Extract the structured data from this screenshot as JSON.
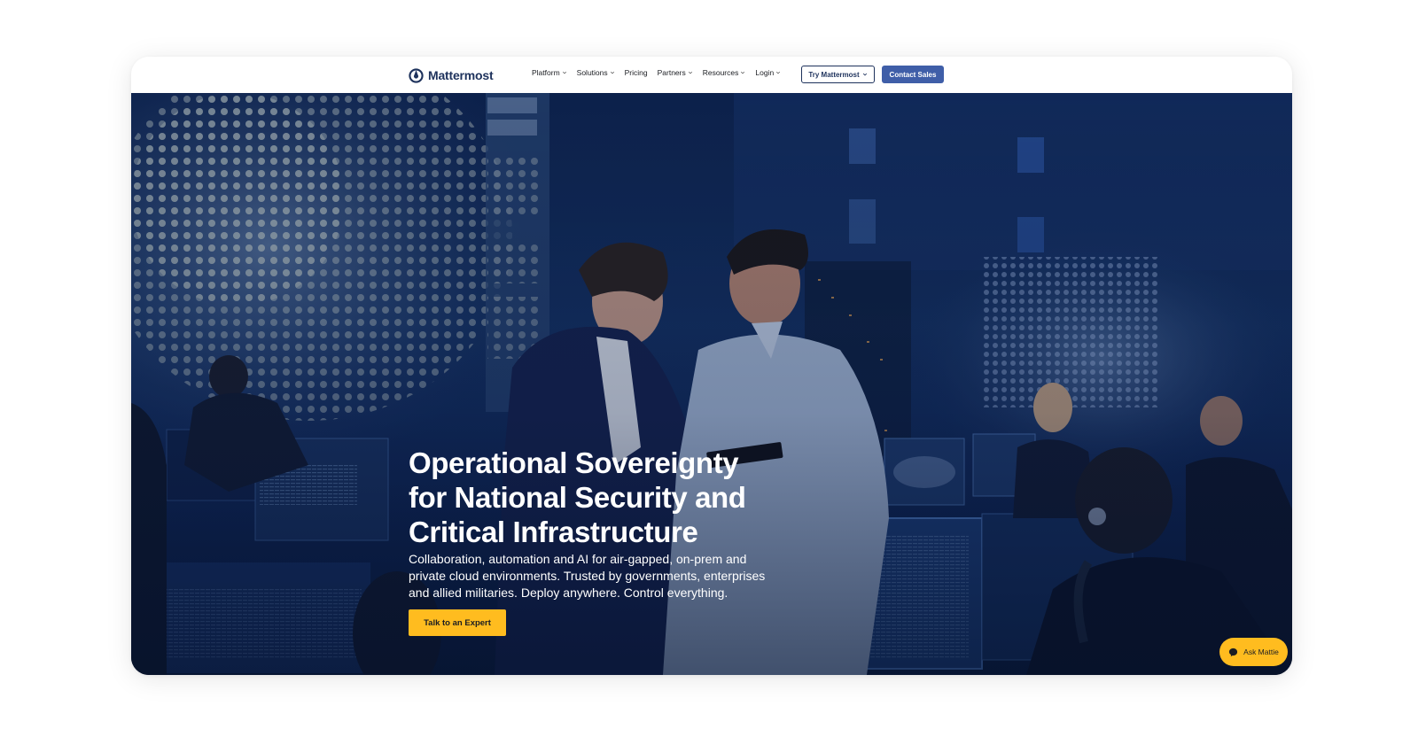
{
  "nav": {
    "logo_text": "Mattermost",
    "logo_icon": "mattermost-logo-icon",
    "links": [
      {
        "label": "Platform",
        "has_dropdown": true
      },
      {
        "label": "Solutions",
        "has_dropdown": true
      },
      {
        "label": "Pricing",
        "has_dropdown": false
      },
      {
        "label": "Partners",
        "has_dropdown": true
      },
      {
        "label": "Resources",
        "has_dropdown": true
      },
      {
        "label": "Login",
        "has_dropdown": true
      }
    ],
    "try_label": "Try Mattermost",
    "sales_label": "Contact Sales"
  },
  "hero": {
    "title": "Operational Sovereignty for National Security and Critical Infrastructure",
    "subtitle": "Collaboration, automation and AI for air-gapped, on-prem and private cloud environments. Trusted by governments, enterprises and allied militaries. Deploy anywhere. Control everything.",
    "cta_label": "Talk to an Expert",
    "background_icon": "control-room-photo"
  },
  "chat_widget": {
    "label": "Ask Mattie",
    "icon": "chat-bubble-icon"
  },
  "colors": {
    "brand_navy": "#1e325c",
    "button_blue": "#3f5ea8",
    "accent_yellow": "#ffbc1f"
  }
}
